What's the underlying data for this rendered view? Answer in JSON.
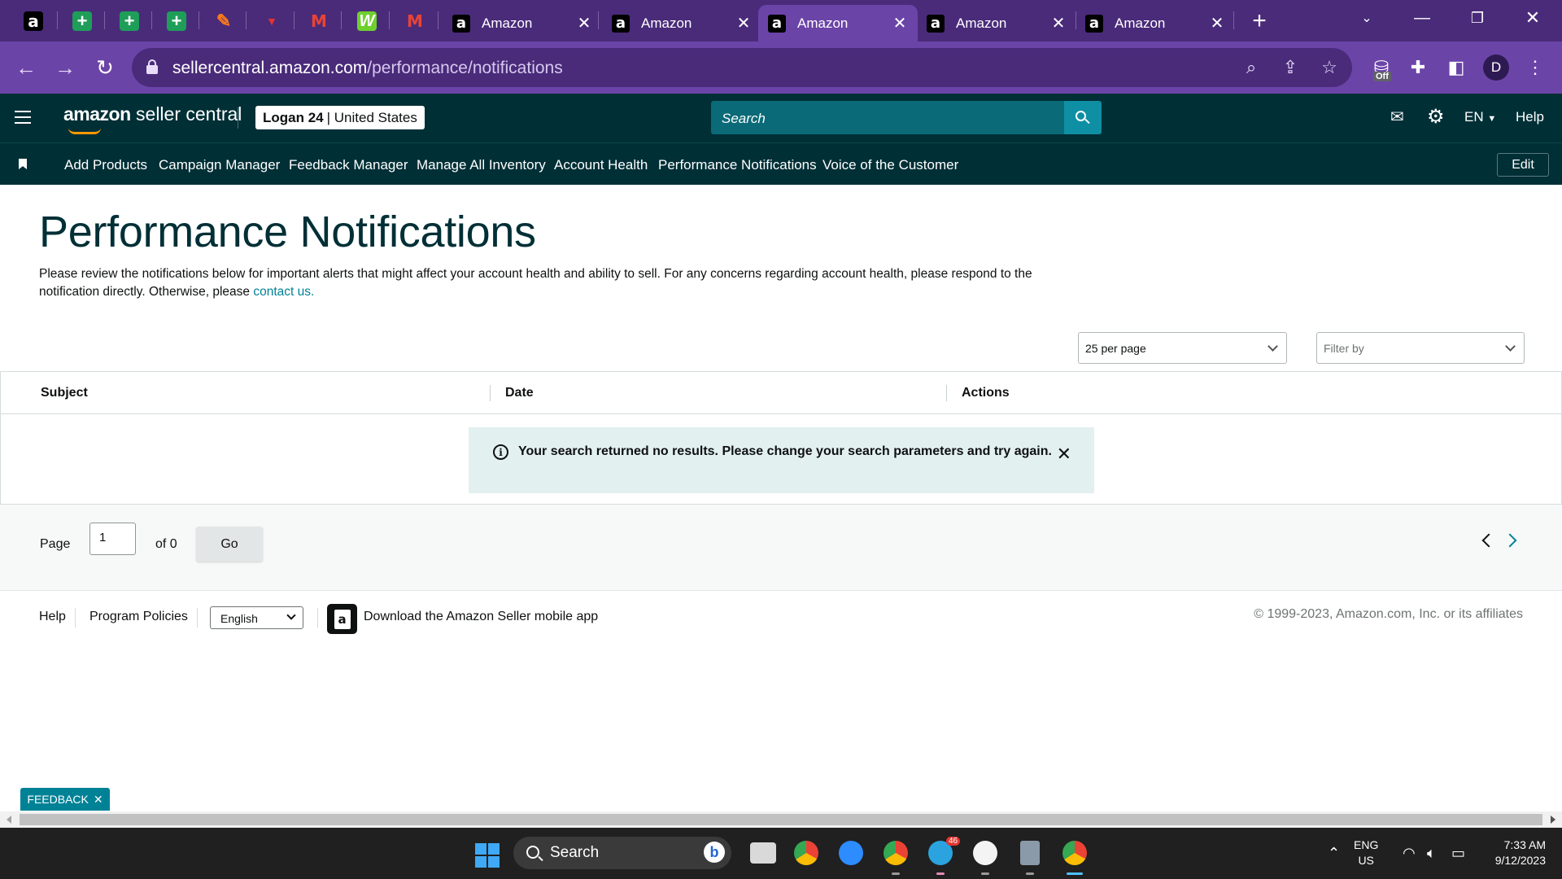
{
  "browser": {
    "tabs": [
      {
        "title": "Amazon",
        "active": false
      },
      {
        "title": "Amazon",
        "active": false
      },
      {
        "title": "Amazon",
        "active": true
      },
      {
        "title": "Amazon",
        "active": false
      },
      {
        "title": "Amazon",
        "active": false
      }
    ],
    "pinned_tab_icons": [
      "amazon-icon",
      "google-sheets-icon",
      "google-sheets-icon",
      "google-sheets-icon",
      "pen-icon",
      "red-logo-icon",
      "gmail-icon",
      "w-app-icon",
      "gmail-icon"
    ],
    "url_host": "sellercentral.amazon.com",
    "url_path": "/performance/notifications",
    "profile_initial": "D",
    "extension_badge": "Off",
    "theme_color": "#6b44a8"
  },
  "header": {
    "logo_bold": "amazon",
    "logo_rest": " seller central",
    "account_name": "Logan 24",
    "account_region": "| United States",
    "search_placeholder": "Search",
    "language": "EN",
    "help": "Help"
  },
  "bookmarks": {
    "items": [
      "Add Products",
      "Campaign Manager",
      "Feedback Manager",
      "Manage All Inventory",
      "Account Health",
      "Performance Notifications",
      "Voice of the Customer"
    ],
    "edit_label": "Edit"
  },
  "main": {
    "title": "Performance Notifications",
    "intro_text": "Please review the notifications below for important alerts that might affect your account health and ability to sell. For any concerns regarding account health, please respond to the notification directly. Otherwise, please ",
    "contact_link": "contact us.",
    "per_page": "25 per page",
    "filter_placeholder": "Filter by",
    "columns": [
      "Subject",
      "Date",
      "Actions"
    ],
    "alert_text": "Your search returned no results. Please change your search parameters and try again.",
    "pager": {
      "page_label": "Page",
      "page_value": "1",
      "of_label": "of 0",
      "go_label": "Go"
    }
  },
  "footer": {
    "help": "Help",
    "program_policies": "Program Policies",
    "language": "English",
    "app_download": "Download the Amazon Seller mobile app",
    "copyright": "© 1999-2023, Amazon.com, Inc. or its affiliates",
    "feedback": "FEEDBACK"
  },
  "taskbar": {
    "search_label": "Search",
    "telegram_badge": "46",
    "lang_line1": "ENG",
    "lang_line2": "US",
    "time": "7:33 AM",
    "date": "9/12/2023"
  }
}
